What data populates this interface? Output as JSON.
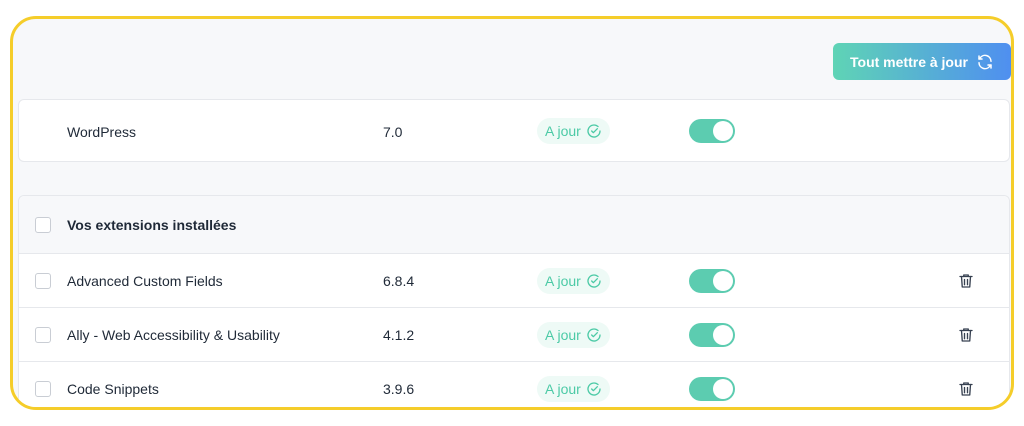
{
  "toolbar": {
    "update_all_label": "Tout mettre à jour"
  },
  "core": {
    "name": "WordPress",
    "version": "7.0",
    "status": "A jour"
  },
  "extensions": {
    "header": "Vos extensions installées",
    "items": [
      {
        "name": "Advanced Custom Fields",
        "version": "6.8.4",
        "status": "A jour"
      },
      {
        "name": "Ally - Web Accessibility & Usability",
        "version": "4.1.2",
        "status": "A jour"
      },
      {
        "name": "Code Snippets",
        "version": "3.9.6",
        "status": "A jour"
      }
    ]
  },
  "colors": {
    "frame_border": "#f5cd2a",
    "accent_green": "#5cccb0",
    "gradient_start": "#5fd4b5",
    "gradient_end": "#4f8ff0"
  },
  "icons": {
    "refresh": "refresh-icon",
    "check": "check-circle-icon",
    "trash": "trash-icon"
  }
}
